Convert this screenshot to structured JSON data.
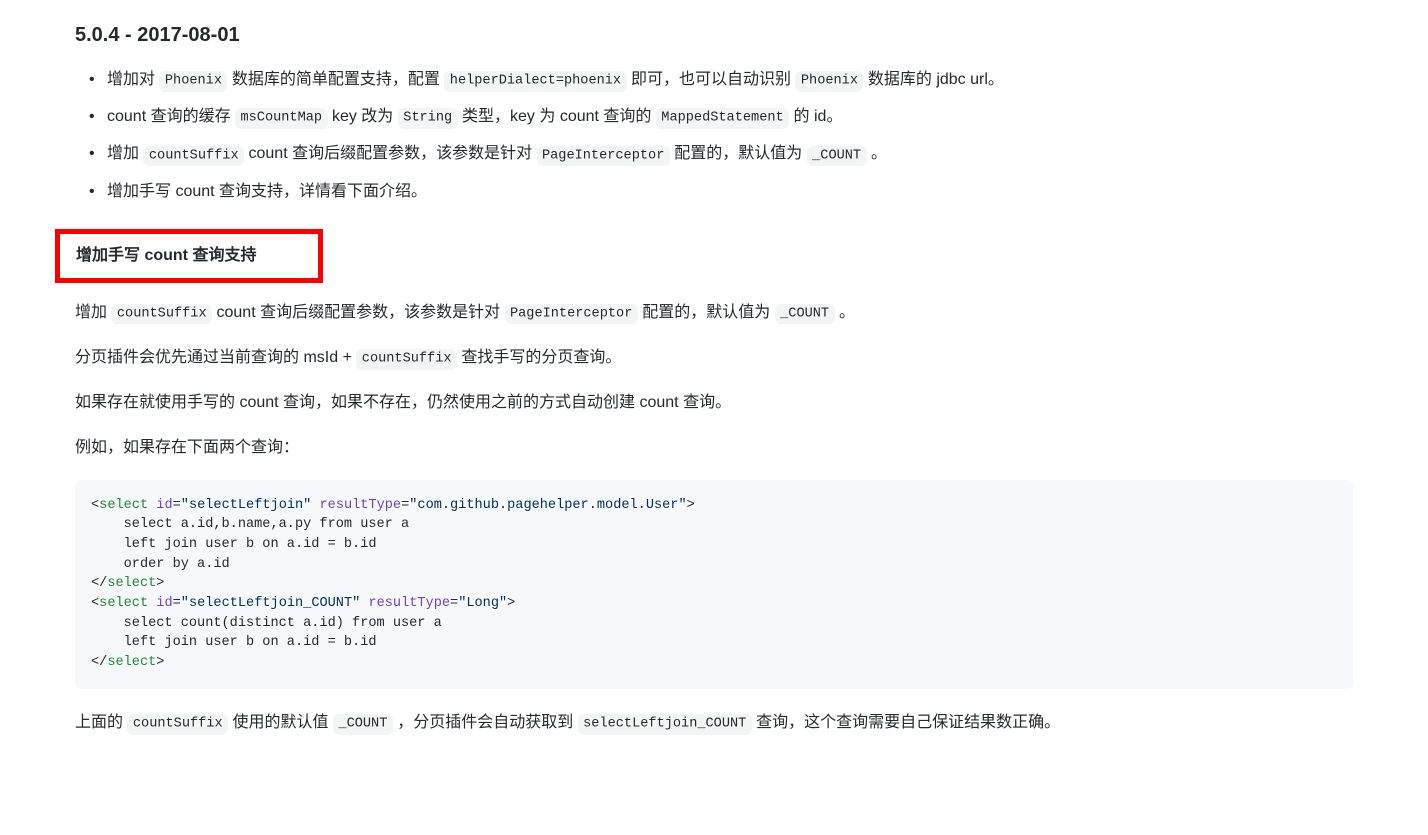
{
  "heading": "5.0.4 - 2017-08-01",
  "bullets": [
    {
      "segments": [
        {
          "t": "text",
          "v": "增加对 "
        },
        {
          "t": "code",
          "v": "Phoenix"
        },
        {
          "t": "text",
          "v": " 数据库的简单配置支持，配置 "
        },
        {
          "t": "code",
          "v": "helperDialect=phoenix"
        },
        {
          "t": "text",
          "v": " 即可，也可以自动识别 "
        },
        {
          "t": "code",
          "v": "Phoenix"
        },
        {
          "t": "text",
          "v": " 数据库的 jdbc url。"
        }
      ]
    },
    {
      "segments": [
        {
          "t": "text",
          "v": "count 查询的缓存 "
        },
        {
          "t": "code",
          "v": "msCountMap"
        },
        {
          "t": "text",
          "v": " key 改为 "
        },
        {
          "t": "code",
          "v": "String"
        },
        {
          "t": "text",
          "v": " 类型，key 为 count 查询的 "
        },
        {
          "t": "code",
          "v": "MappedStatement"
        },
        {
          "t": "text",
          "v": " 的 id。"
        }
      ]
    },
    {
      "segments": [
        {
          "t": "text",
          "v": "增加 "
        },
        {
          "t": "code",
          "v": "countSuffix"
        },
        {
          "t": "text",
          "v": " count 查询后缀配置参数，该参数是针对 "
        },
        {
          "t": "code",
          "v": "PageInterceptor"
        },
        {
          "t": "text",
          "v": " 配置的，默认值为 "
        },
        {
          "t": "code",
          "v": "_COUNT"
        },
        {
          "t": "text",
          "v": " 。"
        }
      ]
    },
    {
      "segments": [
        {
          "t": "text",
          "v": "增加手写 count 查询支持，详情看下面介绍。"
        }
      ]
    }
  ],
  "subheading": "增加手写 count 查询支持",
  "para1": {
    "segments": [
      {
        "t": "text",
        "v": "增加 "
      },
      {
        "t": "code",
        "v": "countSuffix"
      },
      {
        "t": "text",
        "v": " count 查询后缀配置参数，该参数是针对 "
      },
      {
        "t": "code",
        "v": "PageInterceptor"
      },
      {
        "t": "text",
        "v": " 配置的，默认值为 "
      },
      {
        "t": "code",
        "v": "_COUNT"
      },
      {
        "t": "text",
        "v": " 。"
      }
    ]
  },
  "para2": {
    "segments": [
      {
        "t": "text",
        "v": "分页插件会优先通过当前查询的 msId + "
      },
      {
        "t": "code",
        "v": "countSuffix"
      },
      {
        "t": "text",
        "v": " 查找手写的分页查询。"
      }
    ]
  },
  "para3": {
    "segments": [
      {
        "t": "text",
        "v": "如果存在就使用手写的 count 查询，如果不存在，仍然使用之前的方式自动创建 count 查询。"
      }
    ]
  },
  "para4": {
    "segments": [
      {
        "t": "text",
        "v": "例如，如果存在下面两个查询："
      }
    ]
  },
  "code": {
    "lines": [
      [
        {
          "c": "syn-punct",
          "v": "<"
        },
        {
          "c": "syn-tag",
          "v": "select"
        },
        {
          "c": "",
          "v": " "
        },
        {
          "c": "syn-attr",
          "v": "id"
        },
        {
          "c": "syn-punct",
          "v": "="
        },
        {
          "c": "syn-str",
          "v": "\"selectLeftjoin\""
        },
        {
          "c": "",
          "v": " "
        },
        {
          "c": "syn-attr",
          "v": "resultType"
        },
        {
          "c": "syn-punct",
          "v": "="
        },
        {
          "c": "syn-str",
          "v": "\"com.github.pagehelper.model.User\""
        },
        {
          "c": "syn-punct",
          "v": ">"
        }
      ],
      [
        {
          "c": "",
          "v": "    select a.id,b.name,a.py from user a"
        }
      ],
      [
        {
          "c": "",
          "v": "    left join user b on a.id = b.id"
        }
      ],
      [
        {
          "c": "",
          "v": "    order by a.id"
        }
      ],
      [
        {
          "c": "syn-punct",
          "v": "</"
        },
        {
          "c": "syn-tag",
          "v": "select"
        },
        {
          "c": "syn-punct",
          "v": ">"
        }
      ],
      [
        {
          "c": "syn-punct",
          "v": "<"
        },
        {
          "c": "syn-tag",
          "v": "select"
        },
        {
          "c": "",
          "v": " "
        },
        {
          "c": "syn-attr",
          "v": "id"
        },
        {
          "c": "syn-punct",
          "v": "="
        },
        {
          "c": "syn-str",
          "v": "\"selectLeftjoin_COUNT\""
        },
        {
          "c": "",
          "v": " "
        },
        {
          "c": "syn-attr",
          "v": "resultType"
        },
        {
          "c": "syn-punct",
          "v": "="
        },
        {
          "c": "syn-str",
          "v": "\"Long\""
        },
        {
          "c": "syn-punct",
          "v": ">"
        }
      ],
      [
        {
          "c": "",
          "v": "    select count(distinct a.id) from user a"
        }
      ],
      [
        {
          "c": "",
          "v": "    left join user b on a.id = b.id"
        }
      ],
      [
        {
          "c": "syn-punct",
          "v": "</"
        },
        {
          "c": "syn-tag",
          "v": "select"
        },
        {
          "c": "syn-punct",
          "v": ">"
        }
      ]
    ]
  },
  "para5": {
    "segments": [
      {
        "t": "text",
        "v": "上面的 "
      },
      {
        "t": "code",
        "v": "countSuffix"
      },
      {
        "t": "text",
        "v": " 使用的默认值 "
      },
      {
        "t": "code",
        "v": "_COUNT"
      },
      {
        "t": "text",
        "v": " ，分页插件会自动获取到 "
      },
      {
        "t": "code",
        "v": "selectLeftjoin_COUNT"
      },
      {
        "t": "text",
        "v": " 查询，这个查询需要自己保证结果数正确。"
      }
    ]
  }
}
